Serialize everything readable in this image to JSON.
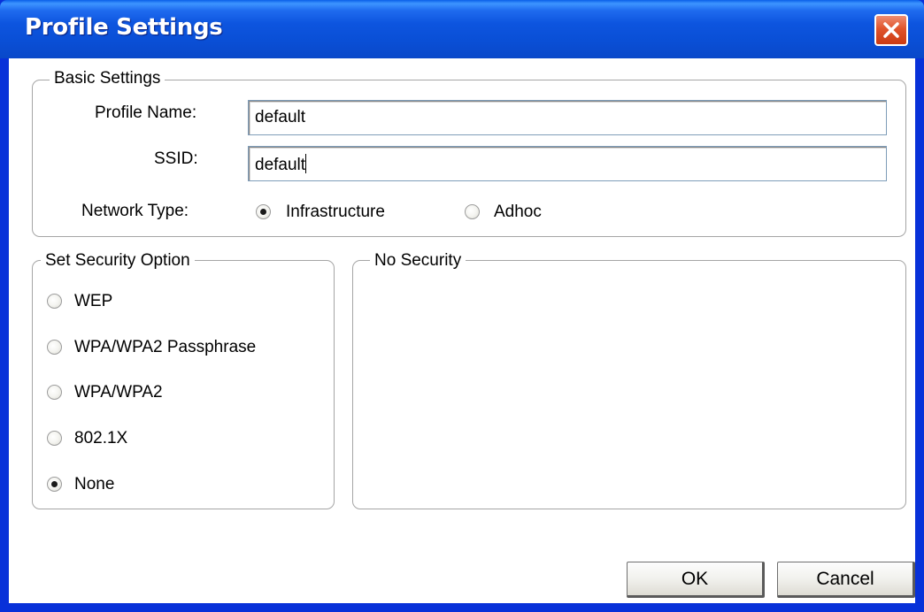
{
  "window": {
    "title": "Profile Settings",
    "close_icon": "close-icon"
  },
  "basic_settings": {
    "legend": "Basic Settings",
    "profile_name_label": "Profile Name:",
    "profile_name_value": "default",
    "ssid_label": "SSID:",
    "ssid_value": "default",
    "network_type_label": "Network Type:",
    "network_types": [
      {
        "label": "Infrastructure",
        "selected": true
      },
      {
        "label": "Adhoc",
        "selected": false
      }
    ]
  },
  "security_option": {
    "legend": "Set Security Option",
    "options": [
      {
        "label": "WEP",
        "selected": false
      },
      {
        "label": "WPA/WPA2 Passphrase",
        "selected": false
      },
      {
        "label": "WPA/WPA2",
        "selected": false
      },
      {
        "label": "802.1X",
        "selected": false
      },
      {
        "label": "None",
        "selected": true
      }
    ]
  },
  "security_detail": {
    "legend": "No Security"
  },
  "buttons": {
    "ok": "OK",
    "cancel": "Cancel"
  },
  "colors": {
    "titlebar": "#0a4fd6",
    "close_button": "#e0542c",
    "group_border": "#a5a5a5"
  }
}
